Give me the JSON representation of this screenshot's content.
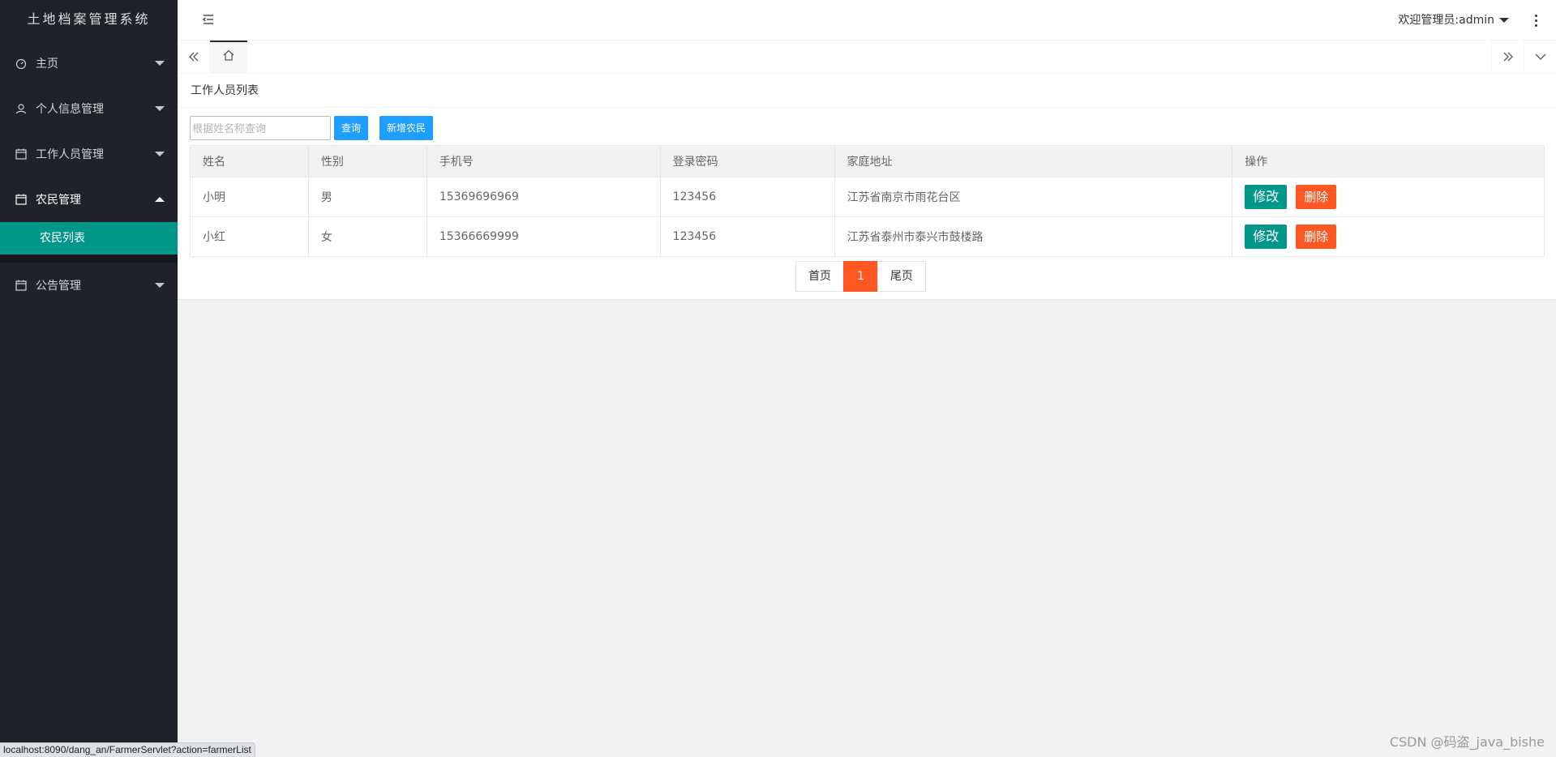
{
  "app": {
    "title": "土地档案管理系统"
  },
  "sidebar": {
    "items": [
      {
        "label": "主页",
        "icon": "dashboard-icon",
        "expanded": false
      },
      {
        "label": "个人信息管理",
        "icon": "user-icon",
        "expanded": false
      },
      {
        "label": "工作人员管理",
        "icon": "calendar-icon",
        "expanded": false
      },
      {
        "label": "农民管理",
        "icon": "calendar-icon",
        "expanded": true,
        "children": [
          {
            "label": "农民列表",
            "active": true
          }
        ]
      },
      {
        "label": "公告管理",
        "icon": "calendar-icon",
        "expanded": false
      }
    ]
  },
  "header": {
    "welcome": "欢迎管理员:admin"
  },
  "page": {
    "title": "工作人员列表",
    "search": {
      "placeholder": "根据姓名称查询",
      "value": ""
    },
    "query_button": "查询",
    "add_button": "新增农民",
    "table": {
      "columns": [
        "姓名",
        "性别",
        "手机号",
        "登录密码",
        "家庭地址",
        "操作"
      ],
      "rows": [
        {
          "name": "小明",
          "gender": "男",
          "phone": "15369696969",
          "password": "123456",
          "address": "江苏省南京市雨花台区"
        },
        {
          "name": "小红",
          "gender": "女",
          "phone": "15366669999",
          "password": "123456",
          "address": "江苏省泰州市泰兴市鼓楼路"
        }
      ],
      "edit_label": "修改",
      "delete_label": "删除"
    },
    "pager": {
      "first": "首页",
      "current": "1",
      "last": "尾页"
    }
  },
  "status_bar": {
    "url": "localhost:8090/dang_an/FarmerServlet?action=farmerList"
  },
  "watermark": "CSDN @码盗_java_bishe",
  "colors": {
    "sidebar_bg": "#20222a",
    "accent": "#009688",
    "danger": "#ff5722",
    "primary": "#1e9fff"
  }
}
